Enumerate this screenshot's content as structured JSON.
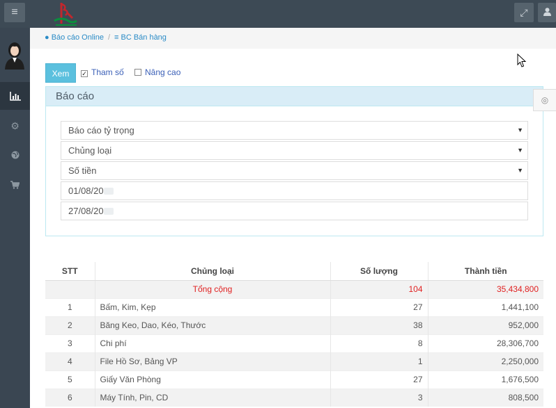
{
  "topbar": {
    "menu_icon": "hamburger-icon",
    "logo": "company-logo",
    "expand_icon": "expand-icon",
    "user_icon": "user-icon"
  },
  "sidebar": {
    "items": [
      {
        "icon": "bar-chart-icon",
        "active": true
      },
      {
        "icon": "gear-icon",
        "active": false
      },
      {
        "icon": "globe-icon",
        "active": false
      },
      {
        "icon": "cart-icon",
        "active": false
      }
    ]
  },
  "breadcrumb": {
    "item1": "Báo cáo Online",
    "item2": "BC Bán hàng"
  },
  "controls": {
    "xem_label": "Xem",
    "tham_so_label": "Tham số",
    "tham_so_checked": true,
    "nang_cao_label": "Nâng cao",
    "nang_cao_checked": false
  },
  "panel": {
    "title": "Báo cáo",
    "report_type": "Báo cáo tỷ trọng",
    "group_by": "Chủng loại",
    "measure": "Số tiền",
    "from_date": "01/08/20",
    "to_date": "27/08/20"
  },
  "table": {
    "headers": [
      "STT",
      "Chủng loại",
      "Số lượng",
      "Thành tiền"
    ],
    "total": {
      "label": "Tổng cộng",
      "qty": "104",
      "amount": "35,434,800"
    },
    "rows": [
      {
        "stt": "1",
        "name": "Bấm, Kim, Kẹp",
        "qty": "27",
        "amount": "1,441,100"
      },
      {
        "stt": "2",
        "name": "Băng Keo, Dao, Kéo, Thước",
        "qty": "38",
        "amount": "952,000"
      },
      {
        "stt": "3",
        "name": "Chi phí",
        "qty": "8",
        "amount": "28,306,700"
      },
      {
        "stt": "4",
        "name": "File Hồ Sơ, Bảng VP",
        "qty": "1",
        "amount": "2,250,000"
      },
      {
        "stt": "5",
        "name": "Giấy Văn Phòng",
        "qty": "27",
        "amount": "1,676,500"
      },
      {
        "stt": "6",
        "name": "Máy Tính, Pin, CD",
        "qty": "3",
        "amount": "808,500"
      }
    ]
  },
  "colors": {
    "topbar": "#3d4a55",
    "sidebar": "#3a4652",
    "accent": "#5bc0de",
    "link": "#2a8bc6",
    "total_text": "#e02020"
  }
}
